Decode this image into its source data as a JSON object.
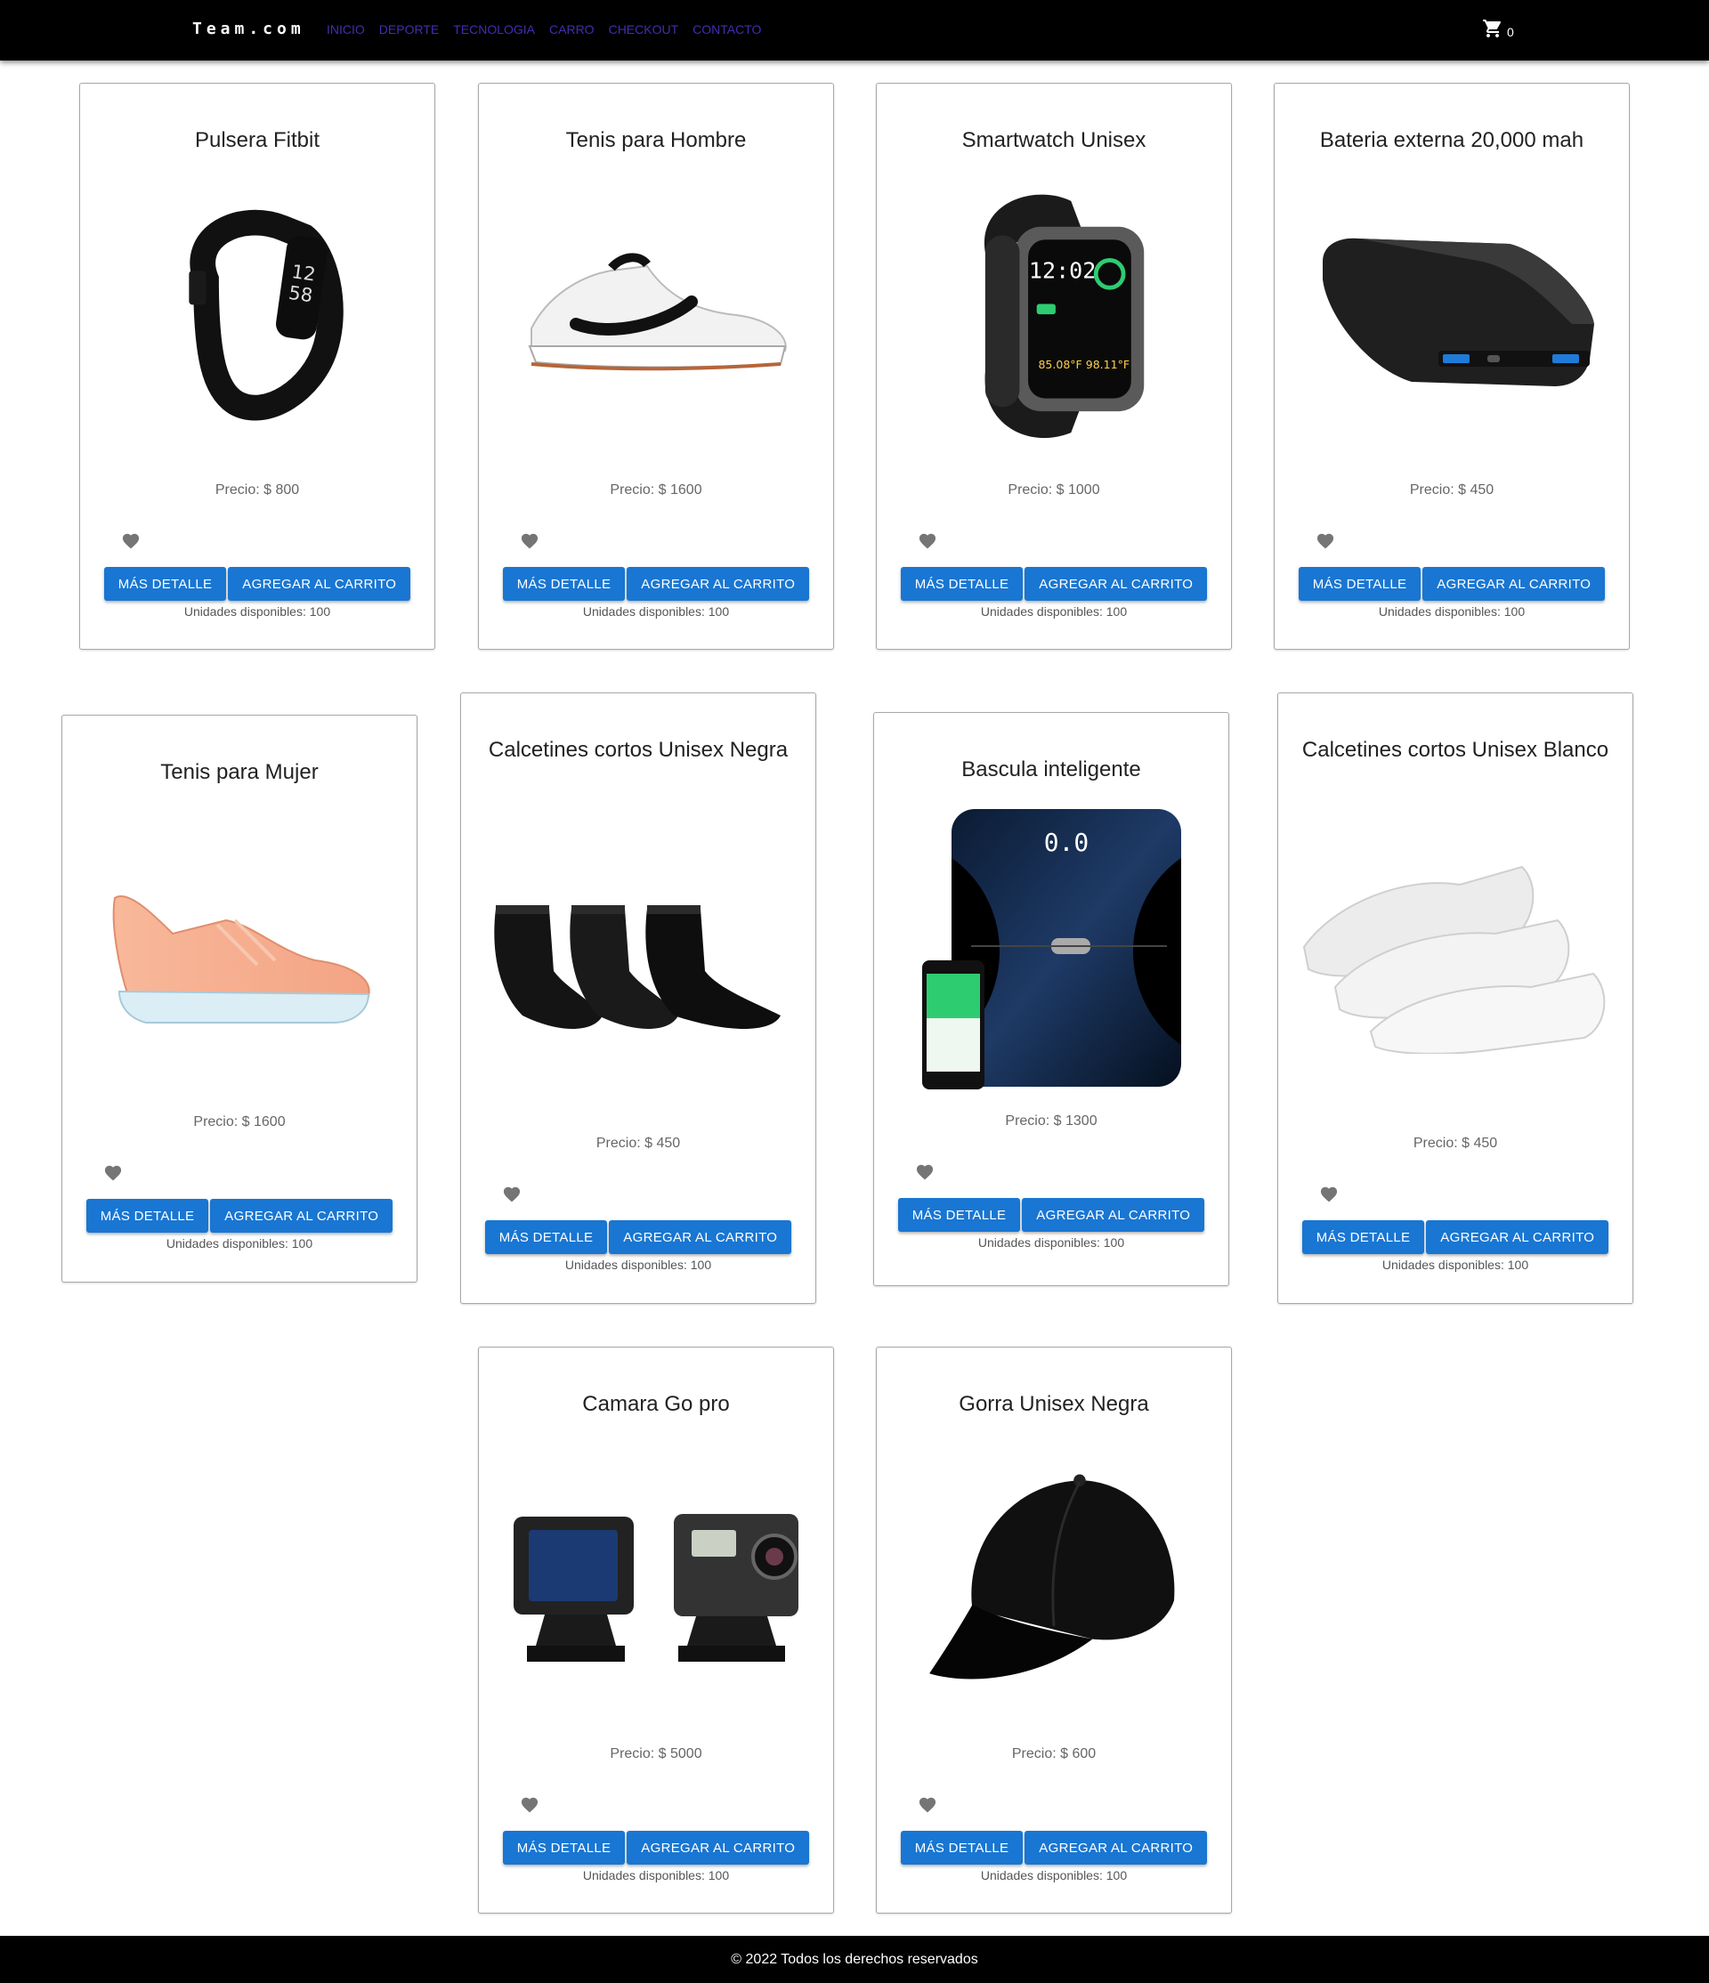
{
  "header": {
    "brand": "Team.com",
    "nav": [
      "INICIO",
      "DEPORTE",
      "TECNOLOGIA",
      "CARRO",
      "CHECKOUT",
      "CONTACTO"
    ],
    "cart_icon": "shopping-cart-icon",
    "cart_count": "0"
  },
  "colors": {
    "navbar_bg": "#000000",
    "nav_link": "#3f2fb0",
    "button_bg": "#1976d2",
    "button_text": "#ffffff",
    "heart": "#757575",
    "footer_bg": "#000000"
  },
  "product_labels": {
    "details_button": "MÁS DETALLE",
    "add_to_cart_button": "AGREGAR AL CARRITO",
    "favorite_icon": "heart-icon"
  },
  "products": [
    {
      "title": "Pulsera Fitbit",
      "price": "Precio: $ 800",
      "units": "Unidades disponibles: 100"
    },
    {
      "title": "Tenis para Hombre",
      "price": "Precio: $ 1600",
      "units": "Unidades disponibles: 100"
    },
    {
      "title": "Smartwatch Unisex",
      "price": "Precio: $ 1000",
      "units": "Unidades disponibles: 100"
    },
    {
      "title": "Bateria externa 20,000 mah",
      "price": "Precio: $ 450",
      "units": "Unidades disponibles: 100"
    },
    {
      "title": "Tenis para Mujer",
      "price": "Precio: $ 1600",
      "units": "Unidades disponibles: 100"
    },
    {
      "title": "Calcetines cortos Unisex Negra",
      "price": "Precio: $ 450",
      "units": "Unidades disponibles: 100"
    },
    {
      "title": "Bascula inteligente",
      "price": "Precio: $ 1300",
      "units": "Unidades disponibles: 100"
    },
    {
      "title": "Calcetines cortos Unisex Blanco",
      "price": "Precio: $ 450",
      "units": "Unidades disponibles: 100"
    },
    {
      "title": "Camara Go pro",
      "price": "Precio: $ 5000",
      "units": "Unidades disponibles: 100"
    },
    {
      "title": "Gorra Unisex Negra",
      "price": "Precio: $ 600",
      "units": "Unidades disponibles: 100"
    }
  ],
  "footer": {
    "text": "© 2022 Todos los derechos reservados"
  }
}
